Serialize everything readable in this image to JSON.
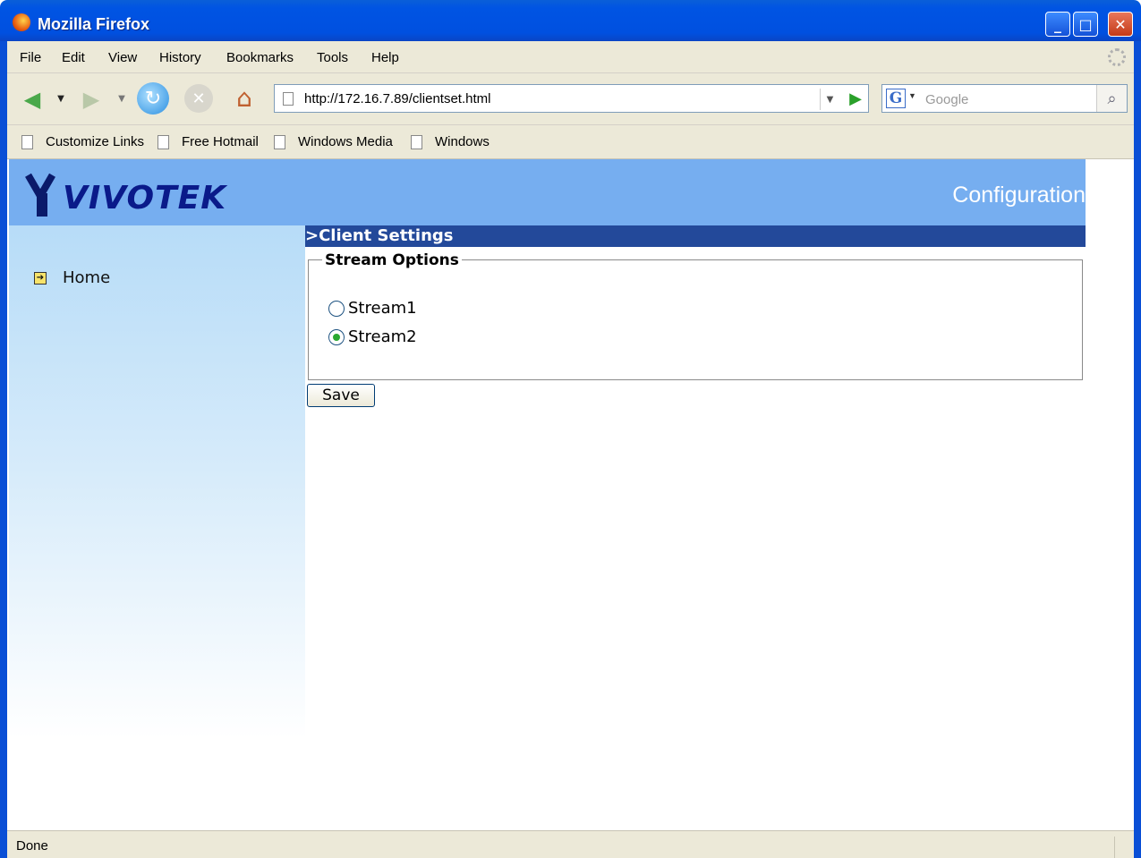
{
  "window": {
    "title": "Mozilla Firefox"
  },
  "menu": [
    "File",
    "Edit",
    "View",
    "History",
    "Bookmarks",
    "Tools",
    "Help"
  ],
  "nav": {
    "url": "http://172.16.7.89/clientset.html",
    "search_placeholder": "Google"
  },
  "bookmarks": [
    "Customize Links",
    "Free Hotmail",
    "Windows Media",
    "Windows"
  ],
  "page": {
    "logo_text": "VIVOTEK",
    "header_title": "Configuration",
    "sidebar": {
      "home_label": "Home"
    },
    "section_title": ">Client Settings",
    "fieldset_legend": "Stream Options",
    "options": [
      {
        "label": "Stream1",
        "selected": false
      },
      {
        "label": "Stream2",
        "selected": true
      }
    ],
    "save_label": "Save"
  },
  "status": {
    "text": "Done"
  },
  "colors": {
    "header_bg": "#76aef0",
    "section_bar": "#23499a",
    "titlebar": "#0054e3"
  }
}
